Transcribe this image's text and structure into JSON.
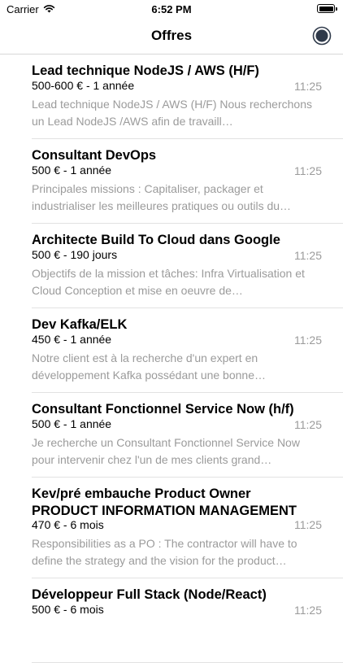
{
  "status_bar": {
    "carrier": "Carrier",
    "time": "6:52 PM"
  },
  "nav": {
    "title": "Offres"
  },
  "offers": [
    {
      "title": "Lead technique NodeJS / AWS (H/F)",
      "subtitle": "500-600 € - 1 année",
      "time": "11:25",
      "description": "Lead technique NodeJS / AWS (H/F) Nous recherchons un Lead NodeJS /AWS afin de travaill…"
    },
    {
      "title": "Consultant DevOps",
      "subtitle": "500 € - 1 année",
      "time": "11:25",
      "description": "Principales missions : Capitaliser, packager et industrialiser les meilleures pratiques ou outils du…"
    },
    {
      "title": "Architecte Build To Cloud dans Google",
      "subtitle": "500 € - 190 jours",
      "time": "11:25",
      "description": "Objectifs de la mission et tâches: Infra Virtualisation et Cloud Conception et mise en oeuvre de…"
    },
    {
      "title": "Dev Kafka/ELK",
      "subtitle": "450 € - 1 année",
      "time": "11:25",
      "description": "Notre client est à la recherche d'un expert en développement Kafka possédant une bonne…"
    },
    {
      "title": "Consultant Fonctionnel Service Now (h/f)",
      "subtitle": "500 € - 1 année",
      "time": "11:25",
      "description": "Je recherche un Consultant Fonctionnel Service Now pour intervenir chez l'un de mes clients grand…"
    },
    {
      "title": "Kev/pré embauche Product Owner PRODUCT INFORMATION MANAGEMENT",
      "subtitle": "470 € - 6 mois",
      "time": "11:25",
      "description": "Responsibilities as a PO : The contractor will have to define the strategy and the vision for the product…"
    },
    {
      "title": "Développeur Full Stack (Node/React)",
      "subtitle": "500 € - 6 mois",
      "time": "11:25",
      "description": ""
    }
  ]
}
